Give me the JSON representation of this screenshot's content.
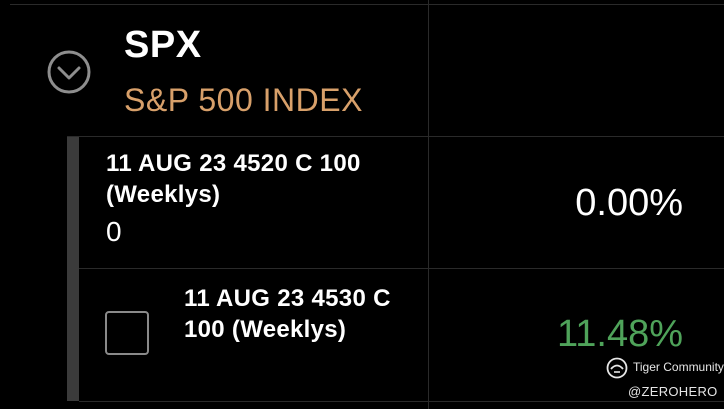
{
  "header": {
    "symbol": "SPX",
    "name": "S&P 500 INDEX",
    "collapse_icon": "chevron-down-circle-icon"
  },
  "positions": [
    {
      "title": "11 AUG 23 4520 C 100 (Weeklys)",
      "quantity": "0",
      "change_pct": "0.00%"
    },
    {
      "title": "11 AUG 23 4530 C 100 (Weeklys)",
      "change_pct": "11.48%",
      "checkbox_icon": "checkbox-unchecked-icon"
    }
  ],
  "colors": {
    "background": "#000000",
    "index_name": "#d8a06a",
    "positive": "#4fa35a",
    "text": "#ffffff",
    "divider": "#2a2a2a"
  },
  "watermark": {
    "brand": "Tiger Community",
    "handle": "@ZEROHERO",
    "icon": "tiger-community-logo-icon"
  }
}
